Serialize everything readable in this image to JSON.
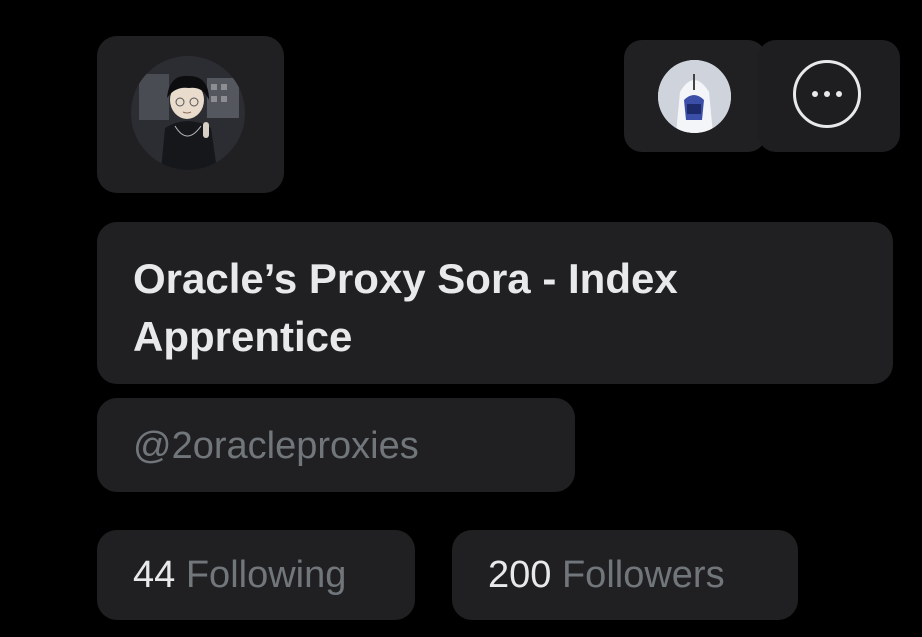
{
  "profile": {
    "display_name": "Oracle’s Proxy Sora - Index Apprentice",
    "handle": "@2oracleproxies",
    "following_count": "44",
    "following_label": "Following",
    "followers_count": "200",
    "followers_label": "Followers"
  },
  "actions": {
    "more_icon": "ellipsis-circle-icon",
    "switch_account_icon": "account-avatar-icon"
  },
  "colors": {
    "background": "#000000",
    "card": "#202023",
    "text_primary": "#e7e9ea",
    "text_secondary": "#71767b"
  }
}
